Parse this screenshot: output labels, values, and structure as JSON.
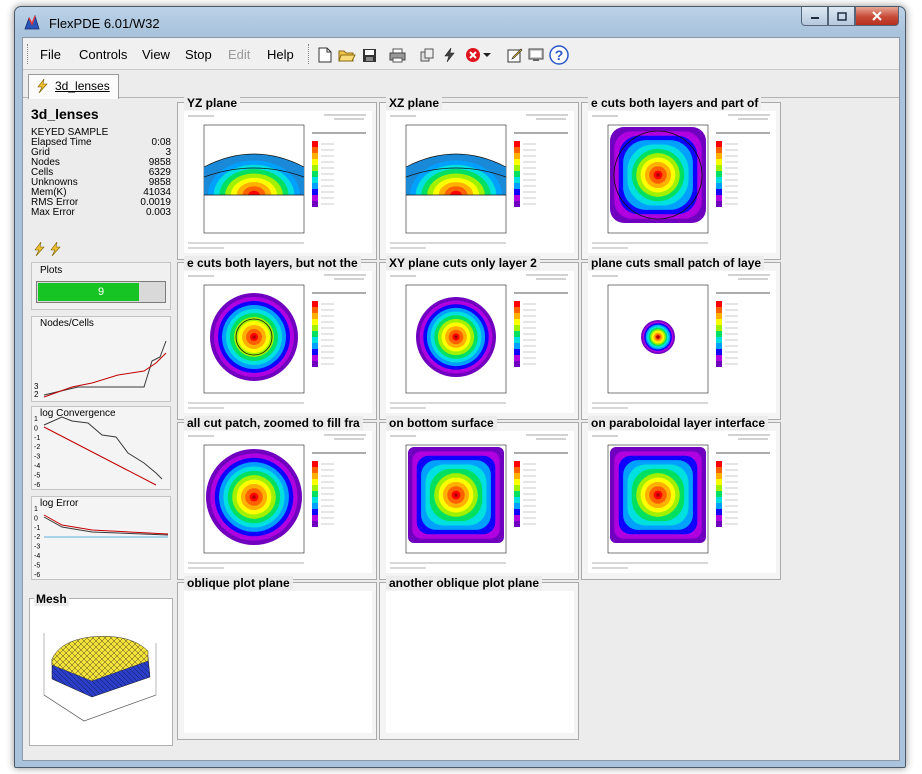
{
  "window": {
    "title": "FlexPDE  6.01/W32",
    "controls": [
      "minimize",
      "maximize",
      "close"
    ]
  },
  "menu": {
    "items": [
      "File",
      "Controls",
      "View",
      "Stop",
      "Edit",
      "Help"
    ],
    "disabled": [
      "Edit"
    ]
  },
  "toolbar": {
    "icons": [
      "new-icon",
      "open-icon",
      "save-icon",
      "print-icon",
      "copy-icon",
      "run-icon",
      "stop-icon",
      "dropdown-icon",
      "edit-icon",
      "monitor-icon",
      "help-icon"
    ]
  },
  "tab": {
    "label": "3d_lenses"
  },
  "status": {
    "model_name": "3d_lenses",
    "mode": "KEYED SAMPLE",
    "rows": [
      {
        "label": "Elapsed Time",
        "value": "0:08"
      },
      {
        "label": "Grid",
        "value": "3"
      },
      {
        "label": "Nodes",
        "value": "9858"
      },
      {
        "label": "Cells",
        "value": "6329"
      },
      {
        "label": "Unknowns",
        "value": "9858"
      },
      {
        "label": "Mem(K)",
        "value": "41034"
      },
      {
        "label": "RMS Error",
        "value": "0.0019"
      },
      {
        "label": "Max Error",
        "value": "0.003"
      }
    ]
  },
  "plots": {
    "label": "Plots",
    "value": "9",
    "progress": 0.79
  },
  "monitors": {
    "nodes_cells": {
      "label": "Nodes/Cells",
      "ticks": [
        "3",
        "2"
      ]
    },
    "log_convergence": {
      "label": "log Convergence",
      "ticks": [
        "1",
        "0",
        "-1",
        "-2",
        "-3",
        "-4",
        "-5",
        "-6"
      ]
    },
    "log_error": {
      "label": "log Error",
      "ticks": [
        "1",
        "0",
        "-1",
        "-2",
        "-3",
        "-4",
        "-5",
        "-6"
      ]
    }
  },
  "mesh": {
    "label": "Mesh"
  },
  "plot_panels": [
    {
      "title": "YZ plane",
      "kind": "dome"
    },
    {
      "title": "XZ plane",
      "kind": "dome"
    },
    {
      "title": "e cuts both layers and part of",
      "kind": "square_circle"
    },
    {
      "title": "e cuts both layers, but not the",
      "kind": "disk_ring"
    },
    {
      "title": "XY plane cuts only layer 2",
      "kind": "disk"
    },
    {
      "title": "plane cuts small patch of laye",
      "kind": "small_disk"
    },
    {
      "title": "all cut patch, zoomed to fill fra",
      "kind": "disk_large"
    },
    {
      "title": "on bottom surface",
      "kind": "square"
    },
    {
      "title": "on paraboloidal layer interface",
      "kind": "square"
    },
    {
      "title": "oblique plot plane",
      "kind": "empty"
    },
    {
      "title": "another oblique plot plane",
      "kind": "empty"
    }
  ],
  "colors": {
    "title_bar": "#a9c3dc",
    "progress_green": "#16c423",
    "nodes_line": "#3a3a3a",
    "cells_line": "#c00000",
    "palette": [
      "#7000c0",
      "#b000e0",
      "#1000ff",
      "#00a0ff",
      "#00e0e0",
      "#00e060",
      "#a0f000",
      "#ffff00",
      "#ffb000",
      "#ff6000",
      "#ff0000"
    ]
  }
}
